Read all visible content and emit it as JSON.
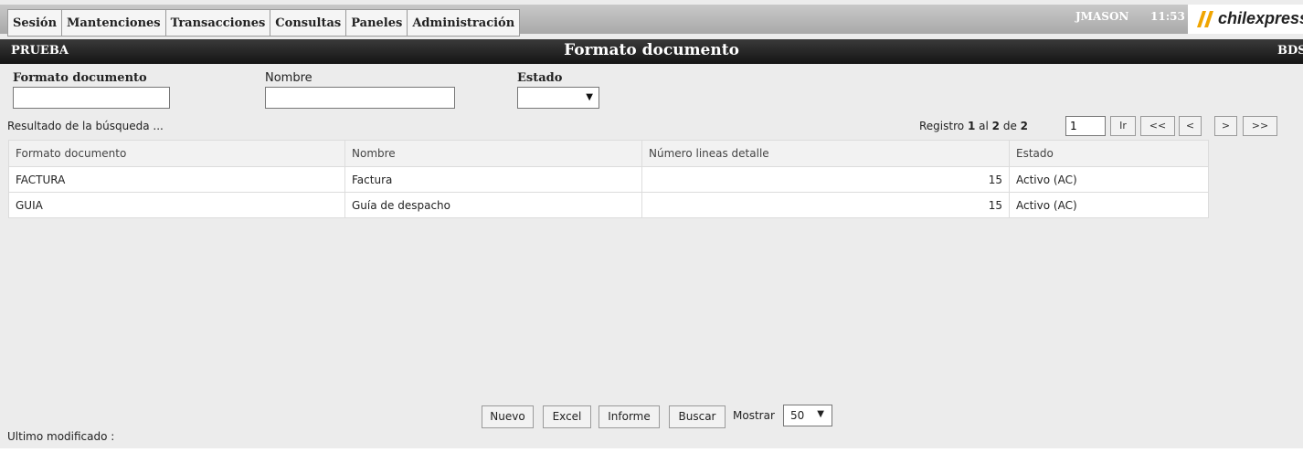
{
  "menu": {
    "items": [
      "Sesión",
      "Mantenciones",
      "Transacciones",
      "Consultas",
      "Paneles",
      "Administración"
    ]
  },
  "header": {
    "user": "JMASON",
    "time": "11:53",
    "brand": "chilexpress"
  },
  "titlebar": {
    "environment": "PRUEBA",
    "title": "Formato documento",
    "code": "BDS"
  },
  "filters": {
    "formato_label": "Formato documento",
    "nombre_label": "Nombre",
    "estado_label": "Estado",
    "formato_value": "",
    "nombre_value": "",
    "estado_value": ""
  },
  "results": {
    "label": "Resultado de la búsqueda ...",
    "registro_prefix": "Registro",
    "from": "1",
    "al": "al",
    "to": "2",
    "de": "de",
    "total": "2",
    "page_value": "1",
    "go_label": "Ir",
    "first_label": "<<",
    "prev_label": "<",
    "next_label": ">",
    "last_label": ">>"
  },
  "table": {
    "columns": [
      "Formato documento",
      "Nombre",
      "Número lineas detalle",
      "Estado"
    ],
    "rows": [
      [
        "FACTURA",
        "Factura",
        "15",
        "Activo (AC)"
      ],
      [
        "GUIA",
        "Guía de despacho",
        "15",
        "Activo (AC)"
      ]
    ]
  },
  "footer": {
    "nuevo": "Nuevo",
    "excel": "Excel",
    "informe": "Informe",
    "buscar": "Buscar",
    "mostrar_label": "Mostrar",
    "mostrar_value": "50",
    "ultimo_modificado": "Ultimo modificado :"
  },
  "colors": {
    "brand_accent": "#f0a500",
    "titlebar": "#1e1e1e",
    "topbar": "#b5b5b5"
  },
  "icons": {
    "dropdown": "chevron-down-icon",
    "logo": "chilexpress-logo-icon"
  }
}
